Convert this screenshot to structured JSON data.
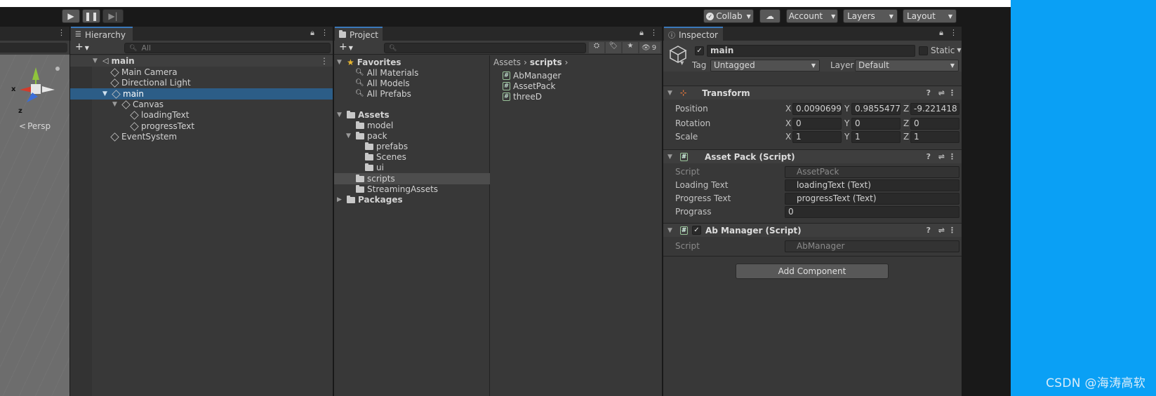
{
  "toolbar": {
    "collab_label": "Collab",
    "account_label": "Account",
    "layers_label": "Layers",
    "layout_label": "Layout"
  },
  "scene": {
    "persp_label": "Persp",
    "axis_x": "x",
    "axis_z": "z"
  },
  "hierarchy": {
    "tab_label": "Hierarchy",
    "search_placeholder": "All",
    "items": [
      {
        "label": "main"
      },
      {
        "label": "Main Camera"
      },
      {
        "label": "Directional Light"
      },
      {
        "label": "main"
      },
      {
        "label": "Canvas"
      },
      {
        "label": "loadingText"
      },
      {
        "label": "progressText"
      },
      {
        "label": "EventSystem"
      }
    ]
  },
  "project": {
    "tab_label": "Project",
    "hidden_count": "9",
    "favorites": {
      "label": "Favorites",
      "items": [
        "All Materials",
        "All Models",
        "All Prefabs"
      ]
    },
    "assets_label": "Assets",
    "folders": [
      "model",
      "pack",
      "prefabs",
      "Scenes",
      "ui",
      "scripts",
      "StreamingAssets"
    ],
    "packages_label": "Packages",
    "breadcrumb": {
      "root": "Assets",
      "current": "scripts"
    },
    "files": [
      "AbManager",
      "AssetPack",
      "threeD"
    ]
  },
  "inspector": {
    "tab_label": "Inspector",
    "object_name": "main",
    "static_label": "Static",
    "tag_label": "Tag",
    "tag_value": "Untagged",
    "layer_label": "Layer",
    "layer_value": "Default",
    "transform": {
      "title": "Transform",
      "position_label": "Position",
      "rotation_label": "Rotation",
      "scale_label": "Scale",
      "x": "X",
      "y": "Y",
      "z": "Z",
      "position": [
        "0.00906992",
        "0.9855477",
        "-9.221418"
      ],
      "rotation": [
        "0",
        "0",
        "0"
      ],
      "scale": [
        "1",
        "1",
        "1"
      ]
    },
    "asset_pack": {
      "title": "Asset Pack (Script)",
      "script_label": "Script",
      "script_value": "AssetPack",
      "loading_label": "Loading Text",
      "loading_value": "loadingText (Text)",
      "progress_label": "Progress Text",
      "progress_value": "progressText (Text)",
      "prograss_label": "Prograss",
      "prograss_value": "0"
    },
    "ab_manager": {
      "title": "Ab Manager (Script)",
      "script_label": "Script",
      "script_value": "AbManager"
    },
    "add_component_label": "Add Component"
  },
  "watermark": "CSDN @海涛高软",
  "colors": {
    "accent": "#3a79bb",
    "selection": "#2c5d87",
    "side_blue": "#0aa0f5"
  }
}
